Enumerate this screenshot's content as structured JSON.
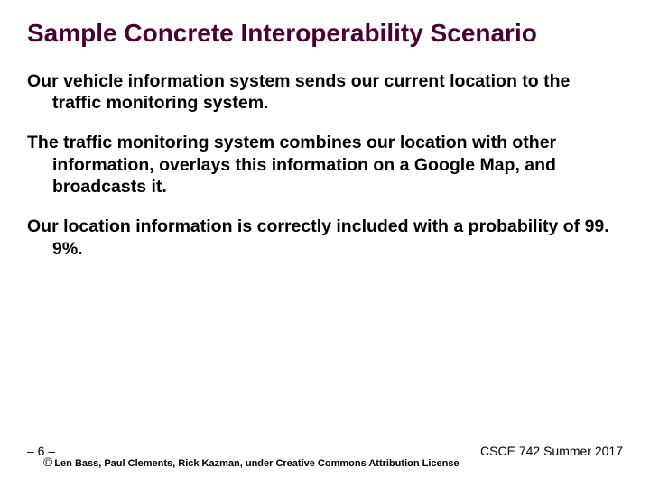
{
  "title": "Sample Concrete Interoperability Scenario",
  "paragraphs": [
    "Our vehicle information system sends our current location to the traffic monitoring system.",
    "The traffic monitoring system combines our location with other information, overlays this information on a Google Map, and broadcasts it.",
    "Our location information is correctly included with a probability of 99. 9%."
  ],
  "footer": {
    "page": "– 6 –",
    "course": "CSCE 742 Summer 2017",
    "copyright": "Len Bass, Paul Clements, Rick Kazman, under Creative Commons Attribution License"
  }
}
